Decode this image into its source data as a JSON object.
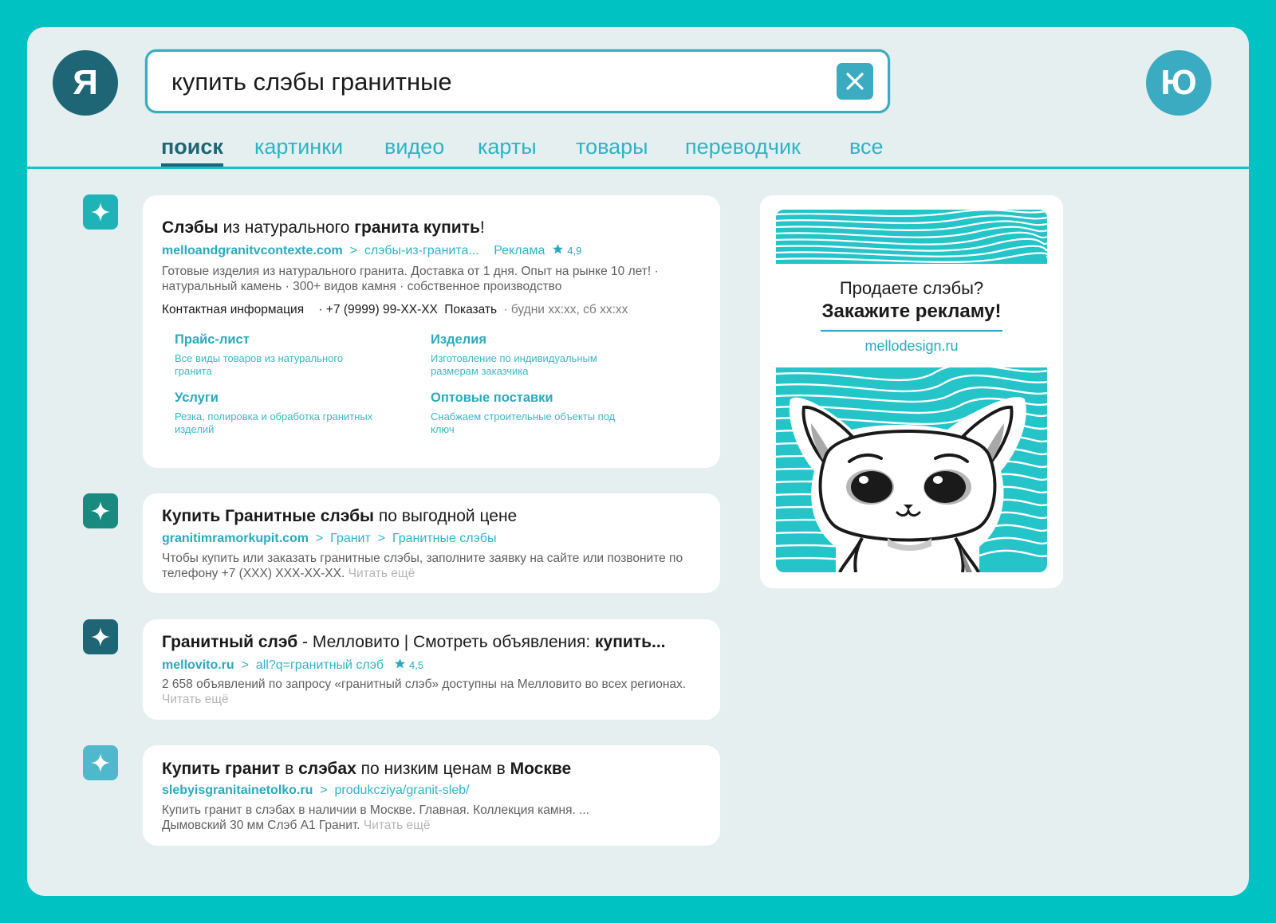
{
  "header": {
    "logo_letter": "Я",
    "avatar_letter": "Ю",
    "search_query": "купить слэбы гранитные"
  },
  "tabs": [
    {
      "label": "поиск",
      "active": true
    },
    {
      "label": "картинки"
    },
    {
      "label": "видео"
    },
    {
      "label": "карты"
    },
    {
      "label": "товары"
    },
    {
      "label": "переводчик"
    },
    {
      "label": "все"
    }
  ],
  "results": [
    {
      "marker_color": "#1fb3b8",
      "title": [
        {
          "t": "Слэбы",
          "b": true
        },
        {
          "t": " из натурального ",
          "b": false
        },
        {
          "t": "гранита купить",
          "b": true
        },
        {
          "t": "!",
          "b": false
        }
      ],
      "domain": "melloandgranitvcontexte.com",
      "path": "  >  слэбы-из-гранита...",
      "ad_label": "Реклама",
      "rating": "4,9",
      "desc": "Готовые изделия из натурального гранита. Доставка от 1 дня. Опыт на рынке 10 лет! · натуральный камень · 300+ видов камня · собственное производство",
      "contacts": {
        "label": "Контактная информация",
        "phone": "· +7 (9999) 99-XX-XX",
        "show": "Показать",
        "hours": "· будни xx:xx, сб xx:xx"
      },
      "sitelinks": [
        {
          "title": "Прайс-лист",
          "desc": "Все виды товаров из натурального гранита"
        },
        {
          "title": "Изделия",
          "desc": "Изготовление по индивидуальным размерам заказчика"
        },
        {
          "title": "Услуги",
          "desc": "Резка, полировка и обработка гранитных изделий"
        },
        {
          "title": "Оптовые поставки",
          "desc": "Снабжаем строительные объекты под ключ"
        }
      ]
    },
    {
      "marker_color": "#188a80",
      "title": [
        {
          "t": "Купить Гранитные слэбы",
          "b": true
        },
        {
          "t": " по выгодной цене",
          "b": false
        }
      ],
      "domain": "granitimramorkupit.com",
      "path": "  >  Гранит  >  Гранитные слэбы",
      "desc": "Чтобы купить или заказать гранитные слэбы, заполните заявку на сайте или позвоните по телефону +7 (XXX) XXX-XX-XX.",
      "more": "Читать ещё"
    },
    {
      "marker_color": "#1e6675",
      "title": [
        {
          "t": "Гранитный слэб",
          "b": true
        },
        {
          "t": " - Мелловито | Смотреть объявления: ",
          "b": false
        },
        {
          "t": "купить...",
          "b": true
        }
      ],
      "domain": "mellovito.ru",
      "path": "  >  all?q=гранитный слэб",
      "rating": "4,5",
      "desc": "2 658 объявлений по запросу «гранитный слэб» доступны на Мелловито во всех регионах.",
      "more": "Читать ещё"
    },
    {
      "marker_color": "#4fb8cc",
      "title": [
        {
          "t": "Купить гранит",
          "b": true
        },
        {
          "t": " в ",
          "b": false
        },
        {
          "t": "слэбах",
          "b": true
        },
        {
          "t": " по низким ценам в ",
          "b": false
        },
        {
          "t": "Москве",
          "b": true
        }
      ],
      "domain": "slebyisgranitainetolko.ru",
      "path": "  >  produkcziya/granit-sleb/",
      "desc": "Купить гранит в слэбах в наличии в Москве. Главная. Коллекция камня. ... Дымовский 30 мм Слэб А1 Гранит.",
      "more": "Читать ещё"
    }
  ],
  "ad": {
    "line1": "Продаете слэбы?",
    "line2": "Закажите рекламу!",
    "url": "mellodesign.ru"
  },
  "colors": {
    "accent": "#2db3c4",
    "dark": "#1e6675",
    "frame": "#00c2c2"
  }
}
